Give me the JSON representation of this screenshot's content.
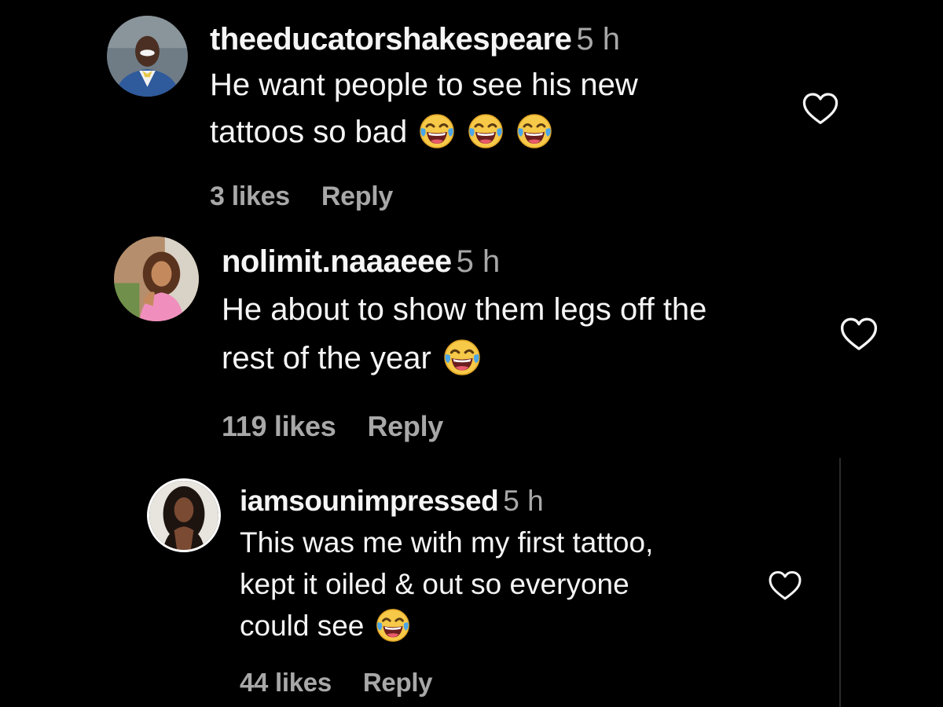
{
  "comments": [
    {
      "username": "theeducatorshakespeare",
      "time": "5 h",
      "lines": [
        "He want people to see his new",
        "tattoos so bad"
      ],
      "emoji": "face-with-tears-of-joy",
      "likes": "3 likes",
      "reply_label": "Reply"
    },
    {
      "username": "nolimit.naaaeee",
      "time": "5 h",
      "lines": [
        "He about to show them legs off the",
        "rest of the year"
      ],
      "emoji": "face-with-tears-of-joy",
      "likes": "119 likes",
      "reply_label": "Reply"
    },
    {
      "username": "iamsounimpressed",
      "time": "5 h",
      "lines": [
        "This was me with my first tattoo,",
        "kept it oiled & out so everyone",
        "could see"
      ],
      "emoji": "face-with-tears-of-joy",
      "likes": "44 likes",
      "reply_label": "Reply"
    }
  ],
  "icons": {
    "like": "heart-outline-icon",
    "emoji": "face-with-tears-of-joy-icon"
  },
  "colors": {
    "background": "#000000",
    "text": "#f5f5f5",
    "secondary": "#a8a8a8"
  }
}
